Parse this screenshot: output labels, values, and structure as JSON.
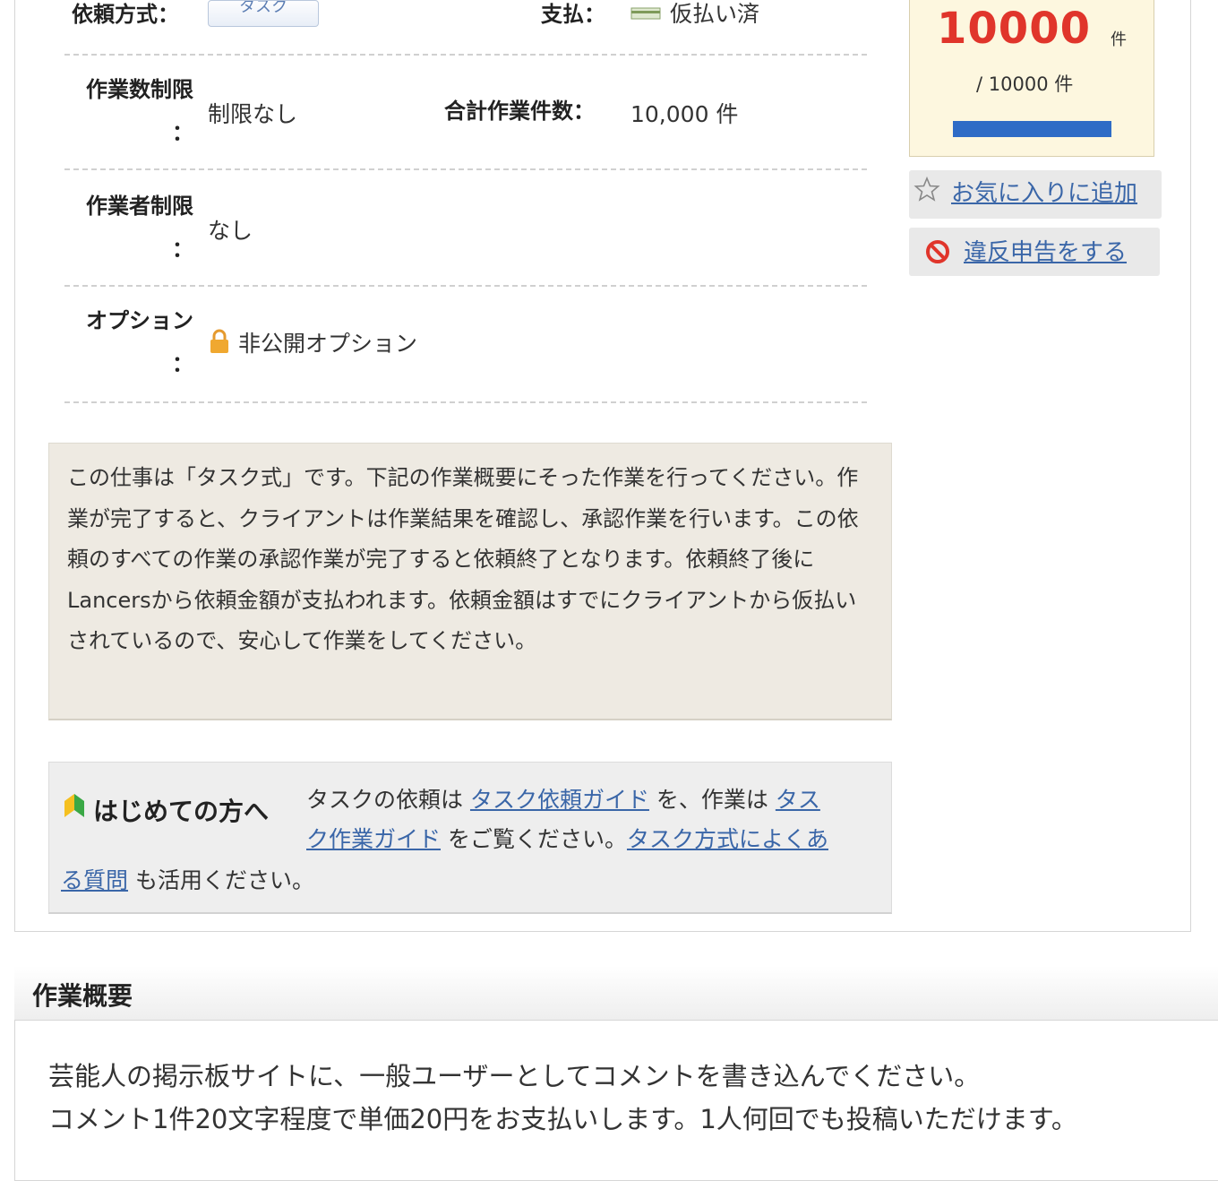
{
  "details": {
    "request_method_label": "依頼方式：",
    "request_method_value": "タスク",
    "payment_label": "支払：",
    "payment_value": "仮払い済",
    "work_limit_label_a": "作業数制限",
    "work_limit_label_b": "：",
    "work_limit_value": "制限なし",
    "total_work_label": "合計作業件数：",
    "total_work_value": "10,000 件",
    "worker_limit_label_a": "作業者制限",
    "worker_limit_label_b": "：",
    "worker_limit_value": "なし",
    "option_label_a": "オプション",
    "option_label_b": "：",
    "option_value": "非公開オプション"
  },
  "notice": {
    "text": "この仕事は「タスク式」です。下記の作業概要にそった作業を行ってください。作業が完了すると、クライアントは作業結果を確認し、承認作業を行います。この依頼のすべての作業の承認作業が完了すると依頼終了となります。依頼終了後にLancersから依頼金額が支払われます。依頼金額はすでにクライアントから仮払いされているので、安心して作業をしてください。"
  },
  "guide": {
    "title": "はじめての方へ",
    "t1": "タスクの依頼は ",
    "link_request_guide": "タスク依頼ガイド",
    "t2": " を、作業は ",
    "link_work_guide_a": "タス",
    "link_work_guide_b": "ク作業ガイド",
    "t3": " をご覧ください。",
    "link_faq_a": "タスク方式によくあ",
    "link_faq_b": "る質問",
    "t4": " も活用ください。"
  },
  "progress": {
    "remaining": "10000",
    "remaining_unit": "件",
    "total": "/ 10000 件",
    "fraction": 1.0
  },
  "sidebar": {
    "favorite_label": "お気に入りに追加",
    "report_label": "違反申告をする"
  },
  "summary": {
    "title": "作業概要",
    "line1": "芸能人の掲示板サイトに、一般ユーザーとしてコメントを書き込んでください。",
    "line2": "コメント1件20文字程度で単価20円をお支払いします。1人何回でも投稿いただけます。"
  },
  "colors": {
    "accent_red": "#e0352b",
    "link_blue": "#3a66a8",
    "progress_blue": "#2f6cc6",
    "notice_bg": "#eeeae2"
  },
  "icons": [
    "card-icon",
    "lock-icon",
    "star-icon",
    "prohibit-icon",
    "beginner-leaf-icon"
  ]
}
